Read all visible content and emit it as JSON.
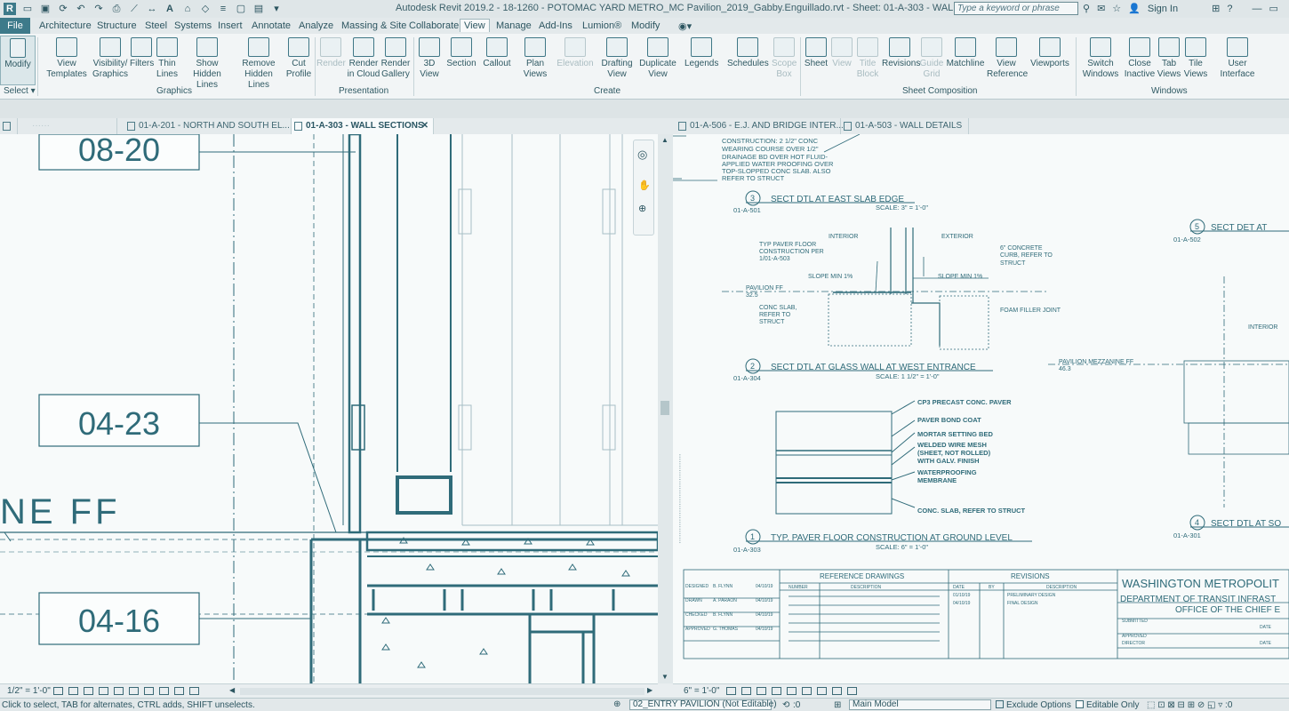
{
  "window": {
    "title": "Autodesk Revit 2019.2 - 18-1260 - POTOMAC YARD METRO_MC Pavilion_2019_Gabby.Enguillado.rvt - Sheet: 01-A-303 - WALL SECTIONS",
    "search_placeholder": "Type a keyword or phrase",
    "sign_in": "Sign In"
  },
  "menu": {
    "tabs": [
      "File",
      "Architecture",
      "Structure",
      "Steel",
      "Systems",
      "Insert",
      "Annotate",
      "Analyze",
      "Massing & Site",
      "Collaborate",
      "View",
      "Manage",
      "Add-Ins",
      "Lumion®",
      "Modify"
    ],
    "active": "View"
  },
  "ribbon": {
    "modify": "Modify",
    "select": "Select ▾",
    "buttons": [
      {
        "l1": "View",
        "l2": "Templates"
      },
      {
        "l1": "Visibility/",
        "l2": "Graphics"
      },
      {
        "l1": "Filters",
        "l2": ""
      },
      {
        "l1": "Thin",
        "l2": "Lines"
      },
      {
        "l1": "Show",
        "l2": "Hidden Lines"
      },
      {
        "l1": "Remove",
        "l2": "Hidden Lines"
      },
      {
        "l1": "Cut",
        "l2": "Profile"
      },
      {
        "l1": "Render",
        "l2": ""
      },
      {
        "l1": "Render",
        "l2": "in Cloud"
      },
      {
        "l1": "Render",
        "l2": "Gallery"
      },
      {
        "l1": "3D",
        "l2": "View"
      },
      {
        "l1": "Section",
        "l2": ""
      },
      {
        "l1": "Callout",
        "l2": ""
      },
      {
        "l1": "Plan",
        "l2": "Views"
      },
      {
        "l1": "Elevation",
        "l2": ""
      },
      {
        "l1": "Drafting",
        "l2": "View"
      },
      {
        "l1": "Duplicate",
        "l2": "View"
      },
      {
        "l1": "Legends",
        "l2": ""
      },
      {
        "l1": "Schedules",
        "l2": ""
      },
      {
        "l1": "Scope",
        "l2": "Box"
      },
      {
        "l1": "Sheet",
        "l2": ""
      },
      {
        "l1": "View",
        "l2": ""
      },
      {
        "l1": "Title",
        "l2": "Block"
      },
      {
        "l1": "Revisions",
        "l2": ""
      },
      {
        "l1": "Guide",
        "l2": "Grid"
      },
      {
        "l1": "Matchline",
        "l2": ""
      },
      {
        "l1": "View",
        "l2": "Reference"
      },
      {
        "l1": "Viewports",
        "l2": ""
      },
      {
        "l1": "Switch",
        "l2": "Windows"
      },
      {
        "l1": "Close",
        "l2": "Inactive"
      },
      {
        "l1": "Tab",
        "l2": "Views"
      },
      {
        "l1": "Tile",
        "l2": "Views"
      },
      {
        "l1": "User",
        "l2": "Interface"
      }
    ],
    "groups": [
      "Graphics",
      "Presentation",
      "Create",
      "Sheet Composition",
      "Windows"
    ]
  },
  "view_tabs": [
    {
      "label": "01-A-201 - NORTH AND SOUTH EL...",
      "active": false
    },
    {
      "label": "01-A-303 - WALL SECTIONS",
      "active": true
    },
    {
      "label": "01-A-506 - E.J. AND BRIDGE INTER...",
      "active": false
    },
    {
      "label": "01-A-503 - WALL DETAILS",
      "active": false
    }
  ],
  "left_view": {
    "tags": [
      "08-20",
      "04-23",
      "04-16"
    ],
    "level_text": "NE  FF",
    "scale": "1/2\" = 1'-0\""
  },
  "right_view": {
    "scale": "6\" = 1'-0\"",
    "note_lines": [
      "CONSTRUCTION: 2 1/2\" CONC",
      "WEARING COURSE OVER 1/2\"",
      "DRAINAGE BD OVER HOT FLUID-",
      "APPLIED WATER PROOFING OVER",
      "TOP-SLOPPED CONC SLAB. ALSO",
      "REFER TO STRUCT"
    ],
    "details": [
      {
        "num": "3",
        "title": "SECT DTL AT EAST SLAB EDGE",
        "ref": "01-A-501",
        "scale": "SCALE: 3\" = 1'-0\""
      },
      {
        "num": "2",
        "title": "SECT DTL AT GLASS WALL AT WEST ENTRANCE",
        "ref": "01-A-304",
        "scale": "SCALE: 1 1/2\" = 1'-0\""
      },
      {
        "num": "1",
        "title": "TYP. PAVER FLOOR CONSTRUCTION AT GROUND LEVEL",
        "ref": "01-A-303",
        "scale": "SCALE: 6\" = 1'-0\""
      },
      {
        "num": "5",
        "title": "SECT DET AT",
        "ref": "01-A-502",
        "scale": ""
      },
      {
        "num": "4",
        "title": "SECT DTL AT SO",
        "ref": "01-A-301",
        "scale": ""
      }
    ],
    "detail3_notes": [
      "INTERIOR",
      "EXTERIOR",
      "TYP PAVER FLOOR",
      "CONSTRUCTION PER",
      "1/01-A-503",
      "6\" CONCRETE",
      "CURB, REFER TO",
      "STRUCT",
      "SLOPE MIN 1%",
      "SLOPE MIN 1%",
      "PAVILION FF",
      "32.5",
      "CONC SLAB,",
      "REFER TO",
      "STRUCT",
      "FOAM FILLER JOINT"
    ],
    "detail1_notes": [
      "CP3 PRECAST CONC. PAVER",
      "PAVER BOND COAT",
      "MORTAR SETTING BED",
      "WELDED WIRE MESH",
      "(SHEET, NOT ROLLED)",
      "WITH GALV. FINISH",
      "WATERPROOFING",
      "MEMBRANE",
      "CONC. SLAB, REFER TO STRUCT"
    ],
    "right_notes": [
      "INTERIOR",
      "PAVILION MEZZANINE FF",
      "46.3"
    ],
    "titleblock": {
      "ref_drawings": "REFERENCE DRAWINGS",
      "number": "NUMBER",
      "description": "DESCRIPTION",
      "revisions": "REVISIONS",
      "date": "DATE",
      "by": "BY",
      "rev_desc": "DESCRIPTION",
      "rows": [
        {
          "role": "DESIGNED",
          "name": "B. FLYNN",
          "date": "04/10/19"
        },
        {
          "role": "DRAWN",
          "name": "A. PARAON",
          "date": "04/10/19"
        },
        {
          "role": "CHECKED",
          "name": "B. FLYNN",
          "date": "04/10/19"
        },
        {
          "role": "APPROVED",
          "name": "G. THOMAS",
          "date": "04/10/19"
        }
      ],
      "revs": [
        {
          "date": "01/10/19",
          "desc": "PRELIMINARY DESIGN"
        },
        {
          "date": "04/10/19",
          "desc": "FINAL DESIGN"
        }
      ],
      "org1": "WASHINGTON METROPOLIT",
      "org2": "DEPARTMENT OF TRANSIT INFRAST",
      "org3": "OFFICE OF THE CHIEF E",
      "submitted": "SUBMITTED",
      "approved": "APPROVED",
      "director": "DIRECTOR",
      "date_lbl": "DATE"
    }
  },
  "status": {
    "hint": "Click to select, TAB for alternates, CTRL adds, SHIFT unselects.",
    "workset": "02_ENTRY PAVILION (Not Editable)",
    "counter": ":0",
    "model": "Main Model",
    "exclude": "Exclude Options",
    "editable": "Editable Only"
  }
}
